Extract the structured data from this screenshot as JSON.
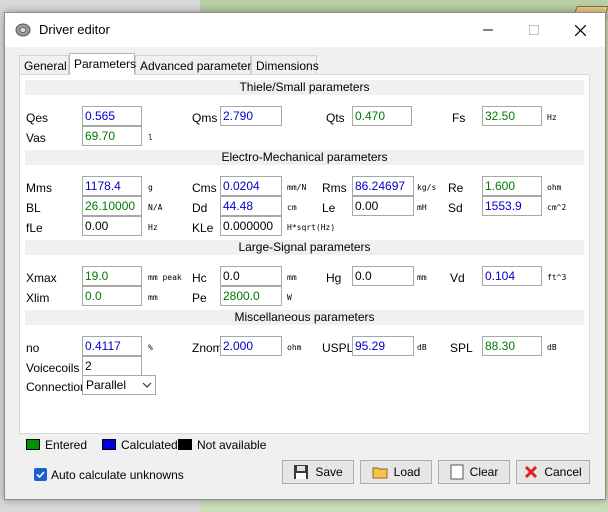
{
  "window": {
    "title": "Driver editor"
  },
  "tabs": [
    {
      "label": "General"
    },
    {
      "label": "Parameters"
    },
    {
      "label": "Advanced parameters"
    },
    {
      "label": "Dimensions"
    }
  ],
  "sections": {
    "ts": "Thiele/Small parameters",
    "em": "Electro-Mechanical parameters",
    "ls": "Large-Signal parameters",
    "misc": "Miscellaneous parameters"
  },
  "fields": {
    "qes": {
      "label": "Qes",
      "value": "0.565",
      "unit": ""
    },
    "qms": {
      "label": "Qms",
      "value": "2.790",
      "unit": ""
    },
    "qts": {
      "label": "Qts",
      "value": "0.470",
      "unit": ""
    },
    "fs": {
      "label": "Fs",
      "value": "32.50",
      "unit": "Hz"
    },
    "vas": {
      "label": "Vas",
      "value": "69.70",
      "unit": "l"
    },
    "mms": {
      "label": "Mms",
      "value": "1178.4",
      "unit": "g"
    },
    "cms": {
      "label": "Cms",
      "value": "0.0204",
      "unit": "mm/N"
    },
    "rms": {
      "label": "Rms",
      "value": "86.24697",
      "unit": "kg/s"
    },
    "re": {
      "label": "Re",
      "value": "1.600",
      "unit": "ohm"
    },
    "bl": {
      "label": "BL",
      "value": "26.10000",
      "unit": "N/A"
    },
    "dd": {
      "label": "Dd",
      "value": "44.48",
      "unit": "cm"
    },
    "le": {
      "label": "Le",
      "value": "0.00",
      "unit": "mH"
    },
    "sd": {
      "label": "Sd",
      "value": "1553.9",
      "unit": "cm^2"
    },
    "fle": {
      "label": "fLe",
      "value": "0.00",
      "unit": "Hz"
    },
    "kle": {
      "label": "KLe",
      "value": "0.000000",
      "unit": "H*sqrt(Hz)"
    },
    "xmax": {
      "label": "Xmax",
      "value": "19.0",
      "unit": "mm  peak"
    },
    "hc": {
      "label": "Hc",
      "value": "0.0",
      "unit": "mm"
    },
    "hg": {
      "label": "Hg",
      "value": "0.0",
      "unit": "mm"
    },
    "vd": {
      "label": "Vd",
      "value": "0.104",
      "unit": "ft^3"
    },
    "xlim": {
      "label": "Xlim",
      "value": "0.0",
      "unit": "mm"
    },
    "pe": {
      "label": "Pe",
      "value": "2800.0",
      "unit": "W"
    },
    "no": {
      "label": "no",
      "value": "0.4117",
      "unit": "%"
    },
    "znom": {
      "label": "Znom",
      "value": "2.000",
      "unit": "ohm"
    },
    "uspl": {
      "label": "USPL",
      "value": "95.29",
      "unit": "dB"
    },
    "spl": {
      "label": "SPL",
      "value": "88.30",
      "unit": "dB"
    },
    "voicecoils": {
      "label": "Voicecoils",
      "value": "2"
    },
    "connection": {
      "label": "Connection",
      "value": "Parallel"
    }
  },
  "legend": {
    "entered": "Entered",
    "calculated": "Calculated",
    "na": "Not available"
  },
  "colors": {
    "entered": "#009000",
    "calculated": "#0000e0",
    "not_available": "#000000"
  },
  "auto_calc": {
    "label": "Auto calculate unknowns",
    "checked": true
  },
  "buttons": {
    "save": "Save",
    "load": "Load",
    "clear": "Clear",
    "cancel": "Cancel"
  }
}
